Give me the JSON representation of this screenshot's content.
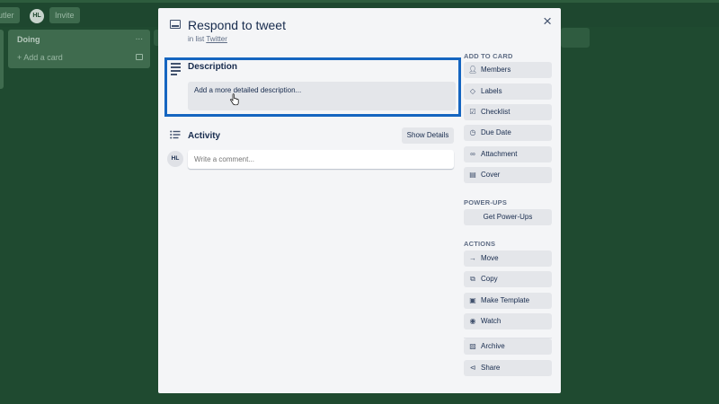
{
  "board": {
    "topbar": {
      "left_button": "Butler",
      "avatar": "HL",
      "invite_button": "Invite"
    },
    "list": {
      "title": "Doing",
      "more": "...",
      "add_card": "+ Add a card"
    }
  },
  "card": {
    "title": "Respond to tweet",
    "list_prefix": "in list ",
    "list_name": "Twitter",
    "close": "×"
  },
  "description": {
    "heading": "Description",
    "placeholder": "Add a more detailed description..."
  },
  "activity": {
    "heading": "Activity",
    "show_details": "Show Details",
    "avatar": "HL",
    "comment_placeholder": "Write a comment..."
  },
  "sidebar": {
    "add_to_card": {
      "heading": "ADD TO CARD",
      "items": [
        {
          "label": "Members",
          "icon": "person-icon"
        },
        {
          "label": "Labels",
          "icon": "tag-icon"
        },
        {
          "label": "Checklist",
          "icon": "checkbox-icon"
        },
        {
          "label": "Due Date",
          "icon": "clock-icon"
        },
        {
          "label": "Attachment",
          "icon": "paperclip-icon"
        },
        {
          "label": "Cover",
          "icon": "cover-icon"
        }
      ]
    },
    "power_ups": {
      "heading": "POWER-UPS",
      "button": "Get Power-Ups"
    },
    "actions": {
      "heading": "ACTIONS",
      "items": [
        {
          "label": "Move",
          "icon": "arrow-right-icon"
        },
        {
          "label": "Copy",
          "icon": "copy-icon"
        },
        {
          "label": "Make Template",
          "icon": "template-icon"
        },
        {
          "label": "Watch",
          "icon": "eye-icon"
        },
        {
          "label": "Archive",
          "icon": "archive-icon"
        },
        {
          "label": "Share",
          "icon": "share-icon"
        }
      ]
    }
  },
  "colors": {
    "board_bg": "#1f4a30",
    "highlight": "#1565c0",
    "modal_bg": "#f4f5f7"
  }
}
